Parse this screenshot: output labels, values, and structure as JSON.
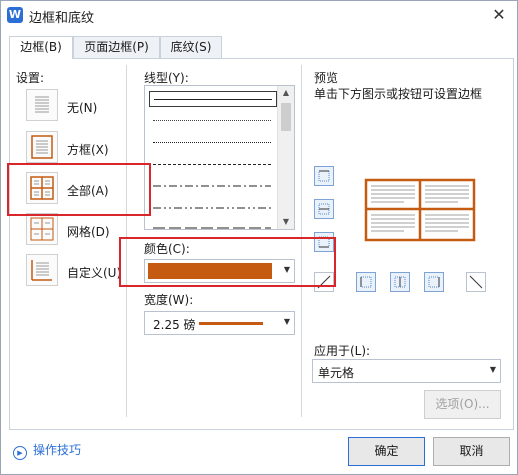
{
  "window": {
    "title": "边框和底纹",
    "close_glyph": "✕"
  },
  "tabs": [
    {
      "label": "边框(B)",
      "active": true
    },
    {
      "label": "页面边框(P)",
      "active": false
    },
    {
      "label": "底纹(S)",
      "active": false
    }
  ],
  "settings": {
    "heading": "设置:",
    "presets": [
      {
        "label": "无(N)",
        "icon": "no-border-icon"
      },
      {
        "label": "方框(X)",
        "icon": "box-border-icon"
      },
      {
        "label": "全部(A)",
        "icon": "all-borders-icon",
        "selected": true
      },
      {
        "label": "网格(D)",
        "icon": "grid-border-icon"
      },
      {
        "label": "自定义(U)",
        "icon": "custom-border-icon"
      }
    ]
  },
  "line_style": {
    "heading": "线型(Y):",
    "styles": [
      "solid",
      "dotted-fine",
      "dotted",
      "dashed",
      "dash-dot",
      "dash-dot-dot",
      "long-dash"
    ]
  },
  "color": {
    "heading": "颜色(C):",
    "value": "#c55a11"
  },
  "width": {
    "heading": "宽度(W):",
    "value": "2.25 磅"
  },
  "preview": {
    "heading": "预览",
    "hint": "单击下方图示或按钮可设置边框",
    "border_color": "#c55a11"
  },
  "apply_to": {
    "heading": "应用于(L):",
    "value": "单元格"
  },
  "buttons": {
    "options": "选项(O)...",
    "ok": "确定",
    "cancel": "取消"
  },
  "tips": {
    "label": "操作技巧"
  },
  "colors": {
    "accent": "#2b6fd6",
    "highlight": "#d9262b"
  }
}
